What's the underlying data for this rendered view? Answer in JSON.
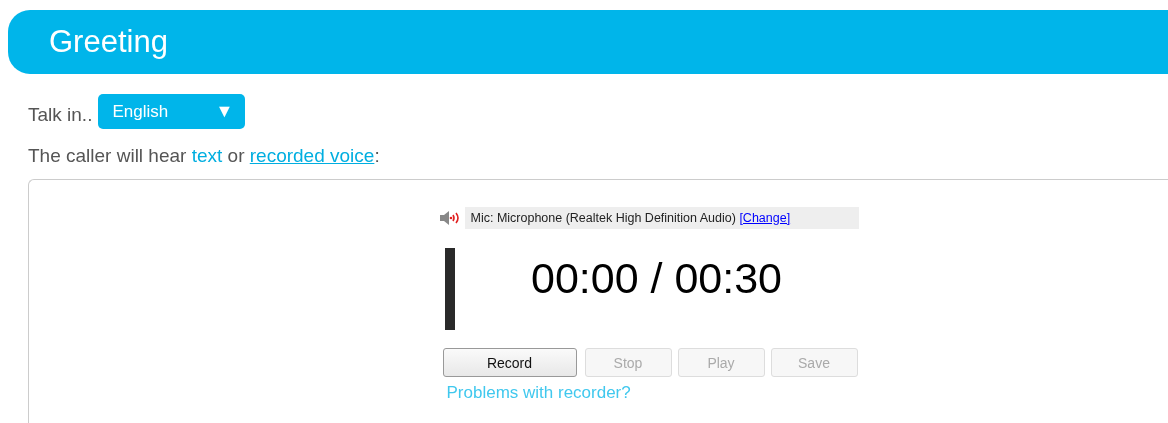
{
  "header": {
    "title": "Greeting"
  },
  "language": {
    "label": "Talk in..",
    "value": "English",
    "caret": "▼"
  },
  "intro": {
    "parts": [
      {
        "kind": "plain",
        "text": "The caller will hear "
      },
      {
        "kind": "link",
        "text": "text",
        "underlined": false
      },
      {
        "kind": "plain",
        "text": " or "
      },
      {
        "kind": "link",
        "text": "recorded voice",
        "underlined": true
      },
      {
        "kind": "plain",
        "text": ":"
      }
    ]
  },
  "recorder": {
    "mic": "Mic: Microphone (Realtek High Definition Audio)",
    "change_link": "[Change]",
    "time": "00:00 / 00:30",
    "buttons": [
      {
        "label": "Record",
        "disabled": false
      },
      {
        "label": "Stop",
        "disabled": true
      },
      {
        "label": "Play",
        "disabled": true
      },
      {
        "label": "Save",
        "disabled": true
      }
    ],
    "help_link": "Problems with recorder?"
  }
}
